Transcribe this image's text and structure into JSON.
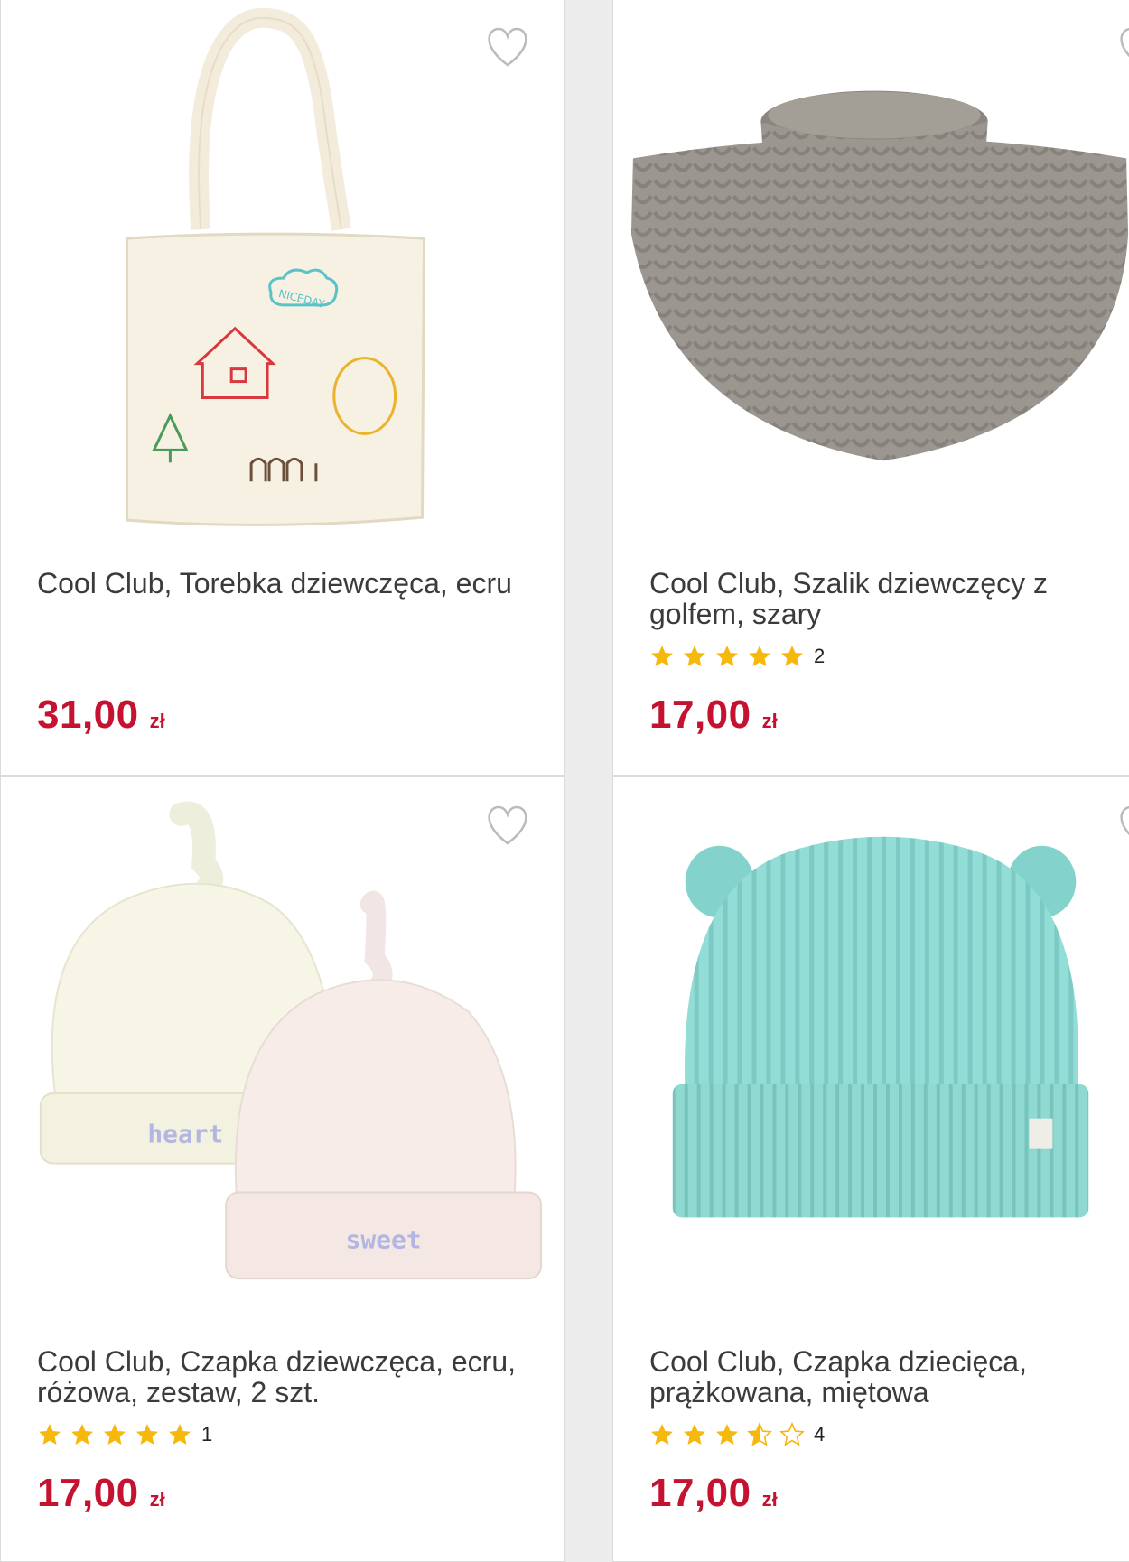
{
  "accent_color": "#c41230",
  "star_color": "#f5b80b",
  "products": [
    {
      "title": "Cool Club, Torebka dziewczęca, ecru",
      "price": "31,00",
      "currency": "zł",
      "image": "tote-bag-ecru",
      "favorite_icon": "heart-outline-icon"
    },
    {
      "title": "Cool Club, Szalik dziewczęcy z golfem, szary",
      "rating": 5,
      "reviews": "2",
      "price": "17,00",
      "currency": "zł",
      "image": "gray-knit-neck-warmer",
      "favorite_icon": "heart-outline-icon"
    },
    {
      "title": "Cool Club, Czapka dziewczęca, ecru, różowa, zestaw, 2 szt.",
      "rating": 5,
      "reviews": "1",
      "price": "17,00",
      "currency": "zł",
      "image": "two-knot-beanies",
      "favorite_icon": "heart-outline-icon"
    },
    {
      "title": "Cool Club, Czapka dziecięca, prążkowana, miętowa",
      "rating": 3.5,
      "reviews": "4",
      "price": "17,00",
      "currency": "zł",
      "image": "mint-beanie-with-ears",
      "favorite_icon": "heart-outline-icon"
    }
  ]
}
